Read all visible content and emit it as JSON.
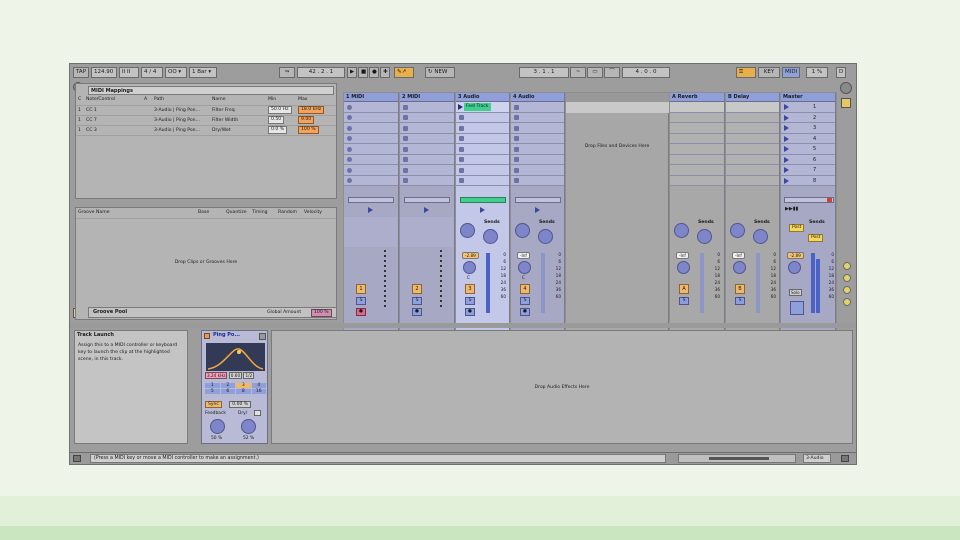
{
  "toolbar": {
    "tap": "TAP",
    "tempo": "124.90",
    "tempo_nudge": "II II",
    "signature": "4 / 4",
    "metronome": "OO",
    "quantize": "1 Bar",
    "arrangement_position": "42 .   2 .   1",
    "new_button": "NEW",
    "loop_start": "3 .   1 .   1",
    "loop_length": "4 .   0 .   0",
    "key_button": "KEY",
    "midi_button": "MIDI",
    "cpu": "1 %",
    "disk": "D"
  },
  "midi_mappings": {
    "title": "MIDI Mappings",
    "columns": [
      "C",
      "Note/Control",
      "A",
      "Path",
      "Name",
      "Min",
      "Max"
    ],
    "rows": [
      {
        "c": "1",
        "control": "CC 1",
        "path": "3-Audio | Ping Pon...",
        "name": "Filter Freq",
        "min": "50.0 Hz",
        "max": "18.0 kHz"
      },
      {
        "c": "1",
        "control": "CC 7",
        "path": "3-Audio | Ping Pon...",
        "name": "Filter Width",
        "min": "0.50",
        "max": "9.00"
      },
      {
        "c": "1",
        "control": "CC 3",
        "path": "3-Audio | Ping Pon...",
        "name": "Dry/Wet",
        "min": "0.0 %",
        "max": "100 %"
      }
    ]
  },
  "groove": {
    "columns": [
      "Groove Name",
      "Base",
      "Quantize",
      "Timing",
      "Random",
      "Velocity"
    ],
    "drop_text": "Drop Clips or Grooves Here",
    "pool_label": "Groove Pool",
    "global_amount_label": "Global Amount",
    "global_amount_value": "100 %"
  },
  "tracks": [
    {
      "name": "1 MIDI",
      "number": "1"
    },
    {
      "name": "2 MIDI",
      "number": "2"
    },
    {
      "name": "3 Audio",
      "number": "3",
      "clip": "Feel Track",
      "volume": "-2.89",
      "pan": "C"
    },
    {
      "name": "4 Audio",
      "number": "4",
      "volume": "-Inf",
      "pan": "C"
    }
  ],
  "returns": [
    {
      "name": "A Reverb",
      "letter": "A",
      "volume": "-Inf"
    },
    {
      "name": "B Delay",
      "letter": "B",
      "volume": "-Inf"
    }
  ],
  "master": {
    "name": "Master",
    "volume": "-2.89",
    "scenes": [
      "1",
      "2",
      "3",
      "4",
      "5",
      "6",
      "7",
      "8"
    ],
    "post": "Post",
    "solo": "Solo"
  },
  "session": {
    "drop_text": "Drop Files and Devices Here",
    "sends_label": "Sends",
    "post_label": "Post",
    "scale": [
      "0",
      "6",
      "12",
      "18",
      "24",
      "36",
      "60"
    ],
    "s_label": "S"
  },
  "info": {
    "title": "Track Launch",
    "text": "Assign this to a MIDI controller or keyboard key to launch the clip at the highlighted scene, in this track."
  },
  "device": {
    "name": "Ping Po...",
    "freq": "3.24 kHz",
    "width": "0.60",
    "mode": "1/2",
    "beat_buttons": [
      "1",
      "2",
      "3",
      "4",
      "5",
      "6",
      "8",
      "16"
    ],
    "sync": "Sync",
    "offset": "0.00 %",
    "feedback_label": "Feedback",
    "feedback_value": "50 %",
    "drywet_label": "Dry/",
    "drywet_value": "52 %"
  },
  "device_drop": "Drop Audio Effects Here",
  "status": {
    "message": "(Press a MIDI key or move a MIDI controller to make an assignment.)",
    "track": "3-Audio"
  }
}
